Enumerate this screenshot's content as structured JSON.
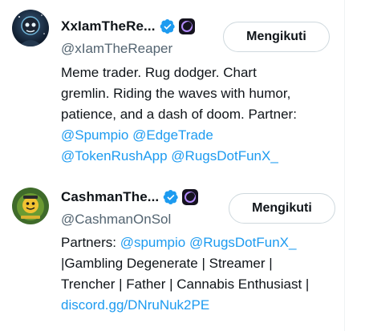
{
  "accounts": [
    {
      "display_name": "XxIamTheRe...",
      "handle": "@xIamTheReaper",
      "follow_label": "Mengikuti",
      "bio": {
        "line1": "Meme trader. Rug dodger. Chart",
        "line2": "gremlin. Riding the waves with humor,",
        "line3": "patience, and a dash of doom. Partner:",
        "mention_spumpio": "@Spumpio",
        "mention_edgetrade": "@EdgeTrade",
        "mention_tokenrush": "@TokenRushApp",
        "mention_rugsdotfun": "@RugsDotFunX_"
      },
      "verified_icon": "verified-badge-icon",
      "affiliate_icon": "affiliate-badge-icon"
    },
    {
      "display_name": "CashmanThe...",
      "handle": "@CashmanOnSol",
      "follow_label": "Mengikuti",
      "bio": {
        "prefix": "Partners: ",
        "mention_spumpio": "@spumpio",
        "mention_rugsdotfun": "@RugsDotFunX_",
        "line2": "|Gambling Degenerate | Streamer |",
        "line3": "Trencher | Father | Cannabis Enthusiast |",
        "link": "discord.gg/DNruNuk2PE"
      },
      "verified_icon": "verified-badge-icon",
      "affiliate_icon": "affiliate-badge-icon"
    }
  ],
  "colors": {
    "link": "#1d9bf0",
    "verified": "#1d9bf0",
    "text": "#0f1419",
    "muted": "#536471"
  }
}
